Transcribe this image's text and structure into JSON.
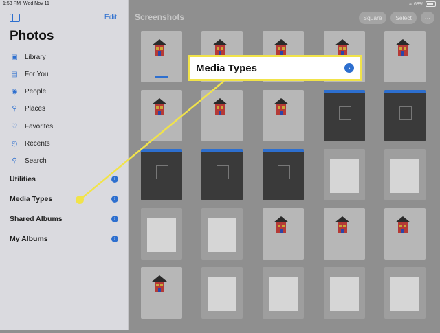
{
  "status_bar": {
    "time": "1:53 PM",
    "date": "Wed Nov 11",
    "battery": "68%"
  },
  "sidebar": {
    "edit_label": "Edit",
    "title": "Photos",
    "items": [
      {
        "label": "Library",
        "icon": "photo-library-icon"
      },
      {
        "label": "For You",
        "icon": "for-you-icon"
      },
      {
        "label": "People",
        "icon": "people-icon"
      },
      {
        "label": "Places",
        "icon": "places-pin-icon"
      },
      {
        "label": "Favorites",
        "icon": "heart-icon"
      },
      {
        "label": "Recents",
        "icon": "clock-icon"
      },
      {
        "label": "Search",
        "icon": "search-icon"
      }
    ],
    "sections": [
      {
        "label": "Utilities"
      },
      {
        "label": "Media Types"
      },
      {
        "label": "Shared Albums"
      },
      {
        "label": "My Albums"
      }
    ]
  },
  "main": {
    "title": "Screenshots",
    "buttons": {
      "square": "Square",
      "select": "Select",
      "more": "···"
    }
  },
  "callout": {
    "label": "Media Types"
  },
  "colors": {
    "accent": "#2d6fcf",
    "highlight": "#f1e34a"
  }
}
